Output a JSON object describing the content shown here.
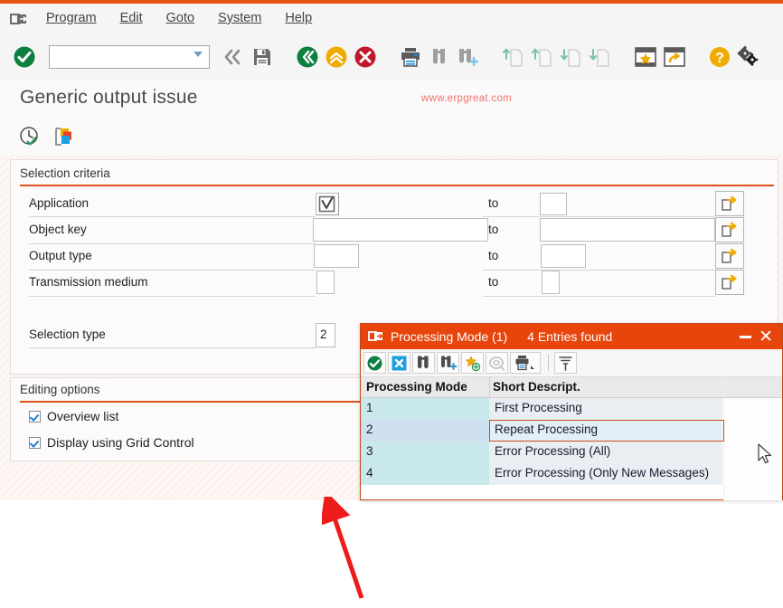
{
  "menubar": {
    "system_icon": "session-icon",
    "items": [
      {
        "label": "Program",
        "accel": "P"
      },
      {
        "label": "Edit",
        "accel": "E"
      },
      {
        "label": "Goto",
        "accel": "G"
      },
      {
        "label": "System",
        "accel": "y"
      },
      {
        "label": "Help",
        "accel": "H"
      }
    ]
  },
  "toolbar": {
    "enter_title": "Enter",
    "command_value": "",
    "command_placeholder": "",
    "icons": [
      {
        "name": "back-icon",
        "title": "Back"
      },
      {
        "name": "save-icon",
        "title": "Save"
      },
      {
        "name": "exit-icon",
        "title": "Exit"
      },
      {
        "name": "up-icon",
        "title": "Back one screen"
      },
      {
        "name": "cancel-icon",
        "title": "Cancel"
      },
      {
        "name": "print-icon",
        "title": "Print"
      },
      {
        "name": "find-icon",
        "title": "Find"
      },
      {
        "name": "find-next-icon",
        "title": "Find Next"
      },
      {
        "name": "first-page-icon",
        "title": "First Page"
      },
      {
        "name": "previous-page-icon",
        "title": "Previous Page"
      },
      {
        "name": "next-page-icon",
        "title": "Next Page"
      },
      {
        "name": "last-page-icon",
        "title": "Last Page"
      },
      {
        "name": "create-favorite-icon",
        "title": "Create Favorite"
      },
      {
        "name": "new-session-icon",
        "title": "Create New Session"
      },
      {
        "name": "help-icon",
        "title": "Help"
      },
      {
        "name": "customize-icon",
        "title": "Customize Local Layout"
      }
    ]
  },
  "screen": {
    "title": "Generic output issue",
    "watermark": "www.erpgreat.com",
    "subtoolbar": [
      {
        "name": "execute-clock-icon",
        "title": "Execute with Background"
      },
      {
        "name": "variants-icon",
        "title": "Get Variant"
      }
    ]
  },
  "selection_criteria": {
    "group_title": "Selection criteria",
    "to_label": "to",
    "select_button_icon": "multiple-selection-icon",
    "rows": [
      {
        "label": "Application",
        "from_value": "",
        "to_value": "",
        "from_multi": true
      },
      {
        "label": "Object key",
        "from_value": "",
        "to_value": "",
        "from_multi": false
      },
      {
        "label": "Output type",
        "from_value": "",
        "to_value": "",
        "from_multi": false
      },
      {
        "label": "Transmission medium",
        "from_value": "",
        "to_value": "",
        "from_multi": false
      }
    ],
    "selection_type": {
      "label": "Selection type",
      "value": "2"
    }
  },
  "editing_options": {
    "group_title": "Editing options",
    "options": [
      {
        "label": "Overview list",
        "checked": true
      },
      {
        "label": "Display using Grid Control",
        "checked": true
      }
    ]
  },
  "dialog": {
    "icon": "session-icon",
    "title": "Processing Mode (1)",
    "entries_found": "4 Entries found",
    "minimize_label": "Minimize",
    "close_label": "Close",
    "toolbar": [
      {
        "name": "copy-check-icon",
        "title": "Copy"
      },
      {
        "name": "cancel-x-icon",
        "title": "Cancel"
      },
      {
        "name": "find-icon",
        "title": "Find"
      },
      {
        "name": "find-next-icon",
        "title": "Find Next"
      },
      {
        "name": "personal-value-list-icon",
        "title": "Personal Value List"
      },
      {
        "name": "info-icon",
        "title": "Information"
      },
      {
        "name": "print-icon",
        "title": "Print"
      },
      {
        "name": "filter-icon",
        "title": "Filter"
      }
    ],
    "table": {
      "columns": [
        "Processing Mode",
        "Short Descript."
      ],
      "rows": [
        {
          "key": "1",
          "desc": "First Processing",
          "selected": false
        },
        {
          "key": "2",
          "desc": "Repeat Processing",
          "selected": true
        },
        {
          "key": "3",
          "desc": "Error Processing (All)",
          "selected": false
        },
        {
          "key": "4",
          "desc": "Error Processing (Only New Messages)",
          "selected": false
        }
      ]
    }
  },
  "annotation": {
    "name": "red-arrow-pointer",
    "color": "#ee1b1b"
  },
  "colors": {
    "accent": "#e8450d",
    "menubar_bg": "#f5f5f5",
    "key_column": "#c9e8ec",
    "selected_row": "#cfe0ee",
    "watermark": "#f0736a"
  }
}
